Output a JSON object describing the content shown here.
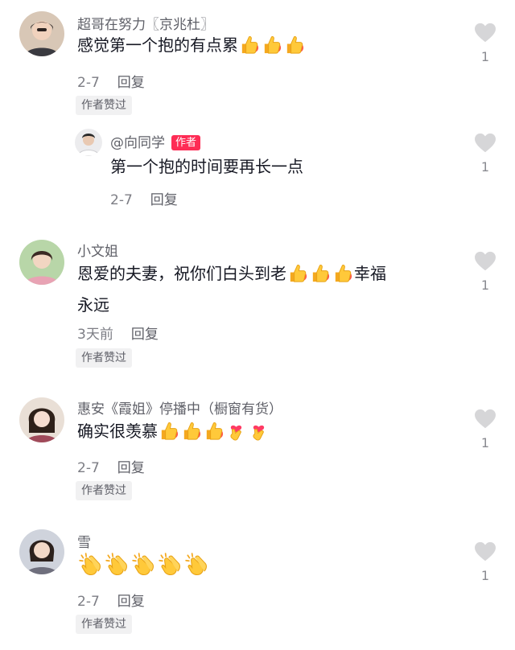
{
  "comments": [
    {
      "username": "超哥在努力〖京兆杜〗",
      "text": "感觉第一个抱的有点累",
      "emojis": [
        "thumbs-up",
        "thumbs-up",
        "thumbs-up"
      ],
      "time": "2-7",
      "reply_label": "回复",
      "liked_label": "作者赞过",
      "like_count": "1",
      "reply": {
        "username": "@向同学",
        "author_tag": "作者",
        "text": "第一个抱的时间要再长一点",
        "time": "2-7",
        "reply_label": "回复",
        "like_count": "1"
      }
    },
    {
      "username": "小文姐",
      "text_line1": "恩爱的夫妻，祝你们白头到老",
      "emojis": [
        "thumbs-up",
        "thumbs-up",
        "thumbs-up"
      ],
      "text_after_emojis": "幸福",
      "text_line2": "永远",
      "time": "3天前",
      "reply_label": "回复",
      "liked_label": "作者赞过",
      "like_count": "1"
    },
    {
      "username": "惠安《霞姐》停播中（橱窗有货）",
      "text": "确实很羡慕",
      "emojis": [
        "thumbs-up",
        "thumbs-up",
        "thumbs-up",
        "finger-heart",
        "finger-heart"
      ],
      "time": "2-7",
      "reply_label": "回复",
      "liked_label": "作者赞过",
      "like_count": "1"
    },
    {
      "username": "雪",
      "text": "",
      "emojis": [
        "clapping-hands",
        "clapping-hands",
        "clapping-hands",
        "clapping-hands",
        "clapping-hands"
      ],
      "time": "2-7",
      "reply_label": "回复",
      "liked_label": "作者赞过",
      "like_count": "1"
    }
  ],
  "icons": {
    "like": "heart-icon",
    "emoji_set": [
      "thumbs-up",
      "finger-heart",
      "clapping-hands"
    ]
  },
  "colors": {
    "author_tag_bg": "#fe2c55",
    "like_icon": "#d6d6d8",
    "emoji_yellow": "#ffc93a"
  }
}
